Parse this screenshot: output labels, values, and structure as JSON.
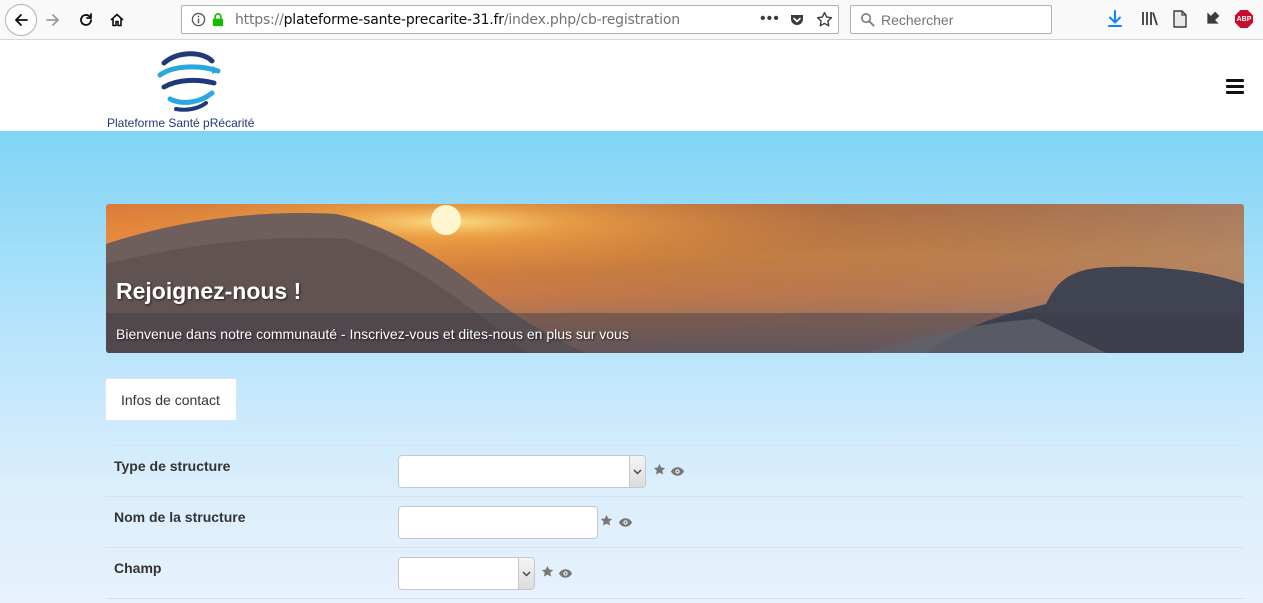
{
  "browser": {
    "url_prefix": "https://",
    "url_host": "plateforme-sante-precarite-31.fr",
    "url_path": "/index.php/cb-registration",
    "search_placeholder": "Rechercher",
    "abp_label": "ABP"
  },
  "site": {
    "logo_text": "Plateforme Santé pRécarité"
  },
  "hero": {
    "title": "Rejoignez-nous !",
    "subtitle": "Bienvenue dans notre communauté - Inscrivez-vous et dites-nous en plus sur vous"
  },
  "tabs": [
    {
      "label": "Infos de contact"
    }
  ],
  "form": {
    "fields": [
      {
        "label": "Type de structure",
        "type": "select",
        "value": ""
      },
      {
        "label": "Nom de la structure",
        "type": "text",
        "value": ""
      },
      {
        "label": "Champ",
        "type": "select",
        "value": ""
      }
    ]
  },
  "colors": {
    "brand_blue": "#1f3a78",
    "accent_cyan": "#29a8df",
    "page_gradient_top": "#7fd5f6"
  }
}
